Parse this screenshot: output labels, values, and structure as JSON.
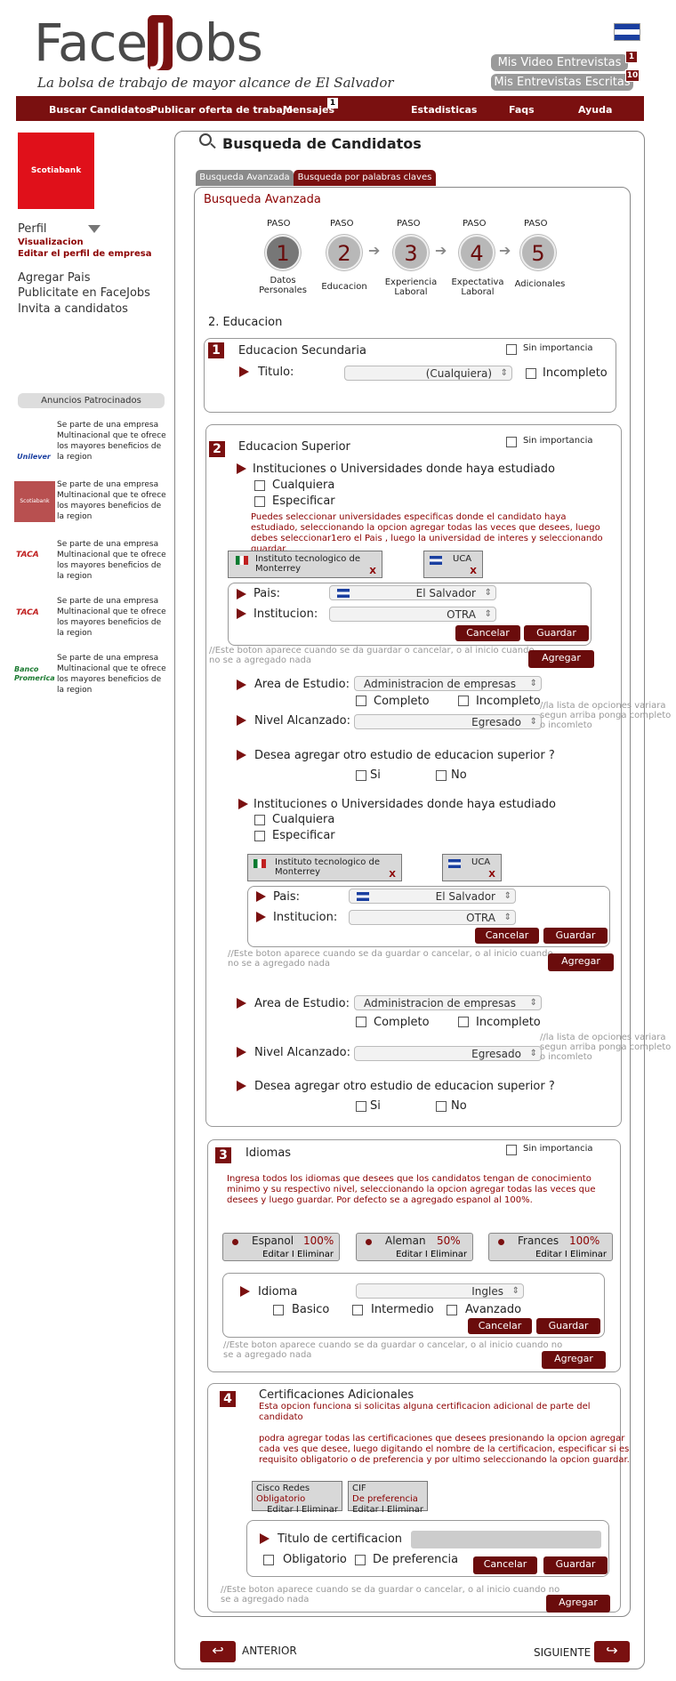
{
  "brand": {
    "name_a": "Face",
    "name_j": "J",
    "name_b": "obs",
    "tagline": "La bolsa de trabajo de mayor alcance de El Salvador"
  },
  "header": {
    "video": "Mis Video Entrevistas",
    "video_count": "1",
    "written": "Mis Entrevistas Escritas",
    "written_count": "10"
  },
  "nav": {
    "items": [
      "Buscar Candidatos",
      "Publicar oferta de trabajo",
      "Mensajes",
      "Estadisticas",
      "Faqs",
      "Ayuda"
    ],
    "msg_count": "1"
  },
  "sidebar": {
    "company_logo": "Scotiabank",
    "perfil": "Perfil",
    "visualizacion": "Visualizacion",
    "editar": "Editar el perfil de empresa",
    "links": [
      "Agregar Pais",
      "Publicitate en FaceJobs",
      "Invita a candidatos"
    ],
    "ads_title": "Anuncios Patrocinados",
    "ad_text": "Se parte de una empresa Multinacional que te ofrece los mayores beneficios de la region",
    "ad_logos": [
      "Unilever",
      "Scotiabank",
      "TACA",
      "TACA",
      "Banco Promerica"
    ]
  },
  "main": {
    "title": "Busqueda de Candidatos",
    "tabs": [
      "Busqueda Avanzada",
      "Busqueda por palabras claves"
    ],
    "subtitle": "Busqueda Avanzada",
    "paso": "PASO",
    "steps": [
      {
        "n": "1",
        "label": "Datos Personales"
      },
      {
        "n": "2",
        "label": "Educacion"
      },
      {
        "n": "3",
        "label": "Experiencia Laboral"
      },
      {
        "n": "4",
        "label": "Expectativa Laboral"
      },
      {
        "n": "5",
        "label": "Adicionales"
      }
    ],
    "section_title": "2. Educacion",
    "sin": "Sin importancia"
  },
  "sec1": {
    "num": "1",
    "title": "Educacion Secundaria",
    "titulo": "Titulo:",
    "titulo_value": "(Cualquiera)",
    "incompleto": "Incompleto"
  },
  "sec2": {
    "num": "2",
    "title": "Educacion Superior",
    "inst_q": "Instituciones o Universidades donde haya estudiado",
    "cualquiera": "Cualquiera",
    "especificar": "Especificar",
    "help": "Puedes seleccionar universidades especificas donde el candidato haya estudiado, seleccionando  la opcion agregar todas las veces que desees, luego debes seleccionar1ero el Pais , luego la universidad  de interes y seleccionando guardar.",
    "chip1": "Instituto tecnologico de Monterrey",
    "chip2": "UCA",
    "x": "X",
    "pais": "Pais:",
    "pais_value": "El Salvador",
    "institucion": "Institucion:",
    "inst_value": "OTRA",
    "cancelar": "Cancelar",
    "guardar": "Guardar",
    "agregar": "Agregar",
    "note_add": "//Este boton aparece cuando se da guardar o cancelar, o al inicio cuando no se a agregado nada",
    "area": "Area de Estudio:",
    "area_value": "Administracion de empresas",
    "completo": "Completo",
    "incompleto": "Incompleto",
    "nivel": "Nivel Alcanzado:",
    "nivel_value": "Egresado",
    "nivel_note": "//la lista de opciones variara segun arriba ponga completo o incomleto",
    "otro": "Desea agregar otro estudio de educacion superior ?",
    "si": "Si",
    "no": "No"
  },
  "sec3": {
    "num": "3",
    "title": "Idiomas",
    "help": "Ingresa todos los idiomas  que desees que los candidatos tengan de conocimiento minimo y su respectivo nivel, seleccionando la opcion agregar todas las veces que desees y luego guardar. Por defecto se a agregado espanol al 100%.",
    "langs": [
      {
        "name": "Espanol",
        "pct": "100%"
      },
      {
        "name": "Aleman",
        "pct": "50%"
      },
      {
        "name": "Frances",
        "pct": "100%"
      }
    ],
    "edit": "Editar I Eliminar",
    "idioma": "Idioma",
    "idioma_value": "Ingles",
    "basico": "Basico",
    "intermedio": "Intermedio",
    "avanzado": "Avanzado"
  },
  "sec4": {
    "num": "4",
    "title": "Certificaciones Adicionales",
    "help1": "Esta opcion funciona si solicitas alguna certificacion adicional de parte del candidato",
    "help2": "podra agregar todas las certificaciones  que  desees presionando la opcion agregar cada ves que desee, luego digitando el nombre de la certificacion, especificar si es requisito obligatorio o de preferencia y por ultimo seleccionando la opcion guardar.",
    "certs": [
      {
        "name": "Cisco Redes",
        "type": "Obligatorio"
      },
      {
        "name": "CIF",
        "type": "De preferencia"
      }
    ],
    "titulo_cert": "Titulo de certificacion",
    "obligatorio": "Obligatorio",
    "preferencia": "De preferencia"
  },
  "footer": {
    "anterior": "ANTERIOR",
    "siguiente": "SIGUIENTE"
  }
}
